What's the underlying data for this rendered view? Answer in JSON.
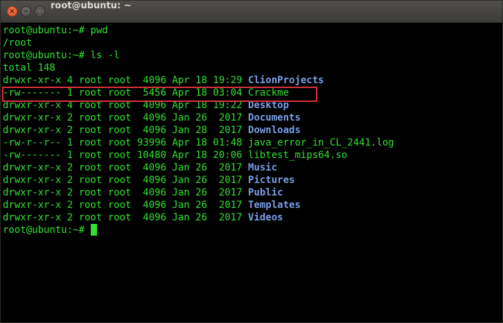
{
  "window": {
    "title": "root@ubuntu: ~",
    "buttons": {
      "close": "×",
      "minimize": "−",
      "maximize": "□"
    }
  },
  "terminal": {
    "prompt": "root@ubuntu:~#",
    "cmd1": "pwd",
    "out1": "/root",
    "cmd2": "ls -l",
    "total": "total 148",
    "entries": [
      {
        "meta": "drwxr-xr-x 4 root root  4096 Apr 18 19:29",
        "name": "ClionProjects"
      },
      {
        "meta": "-rw------- 1 root root  5456 Apr 18 03:04",
        "name": "Crackme"
      },
      {
        "meta": "drwxr-xr-x 4 root root  4096 Apr 18 19:22",
        "name": "Desktop"
      },
      {
        "meta": "drwxr-xr-x 2 root root  4096 Jan 26  2017",
        "name": "Documents"
      },
      {
        "meta": "drwxr-xr-x 2 root root  4096 Jan 28  2017",
        "name": "Downloads"
      },
      {
        "meta": "-rw-r--r-- 1 root root 93996 Apr 18 01:48",
        "name": "java_error_in_CL_2441.log"
      },
      {
        "meta": "-rw------- 1 root root 10480 Apr 18 20:06",
        "name": "libtest_mips64.so"
      },
      {
        "meta": "drwxr-xr-x 2 root root  4096 Jan 26  2017",
        "name": "Music"
      },
      {
        "meta": "drwxr-xr-x 2 root root  4096 Jan 26  2017",
        "name": "Pictures"
      },
      {
        "meta": "drwxr-xr-x 2 root root  4096 Jan 26  2017",
        "name": "Public"
      },
      {
        "meta": "drwxr-xr-x 2 root root  4096 Jan 26  2017",
        "name": "Templates"
      },
      {
        "meta": "drwxr-xr-x 2 root root  4096 Jan 26  2017",
        "name": "Videos"
      }
    ]
  },
  "colors": {
    "terminal_text": "#31e131",
    "directory_name": "#7a9fe6",
    "background": "#000000",
    "highlight_box": "#e0333c",
    "titlebar": "#3c3b37"
  }
}
